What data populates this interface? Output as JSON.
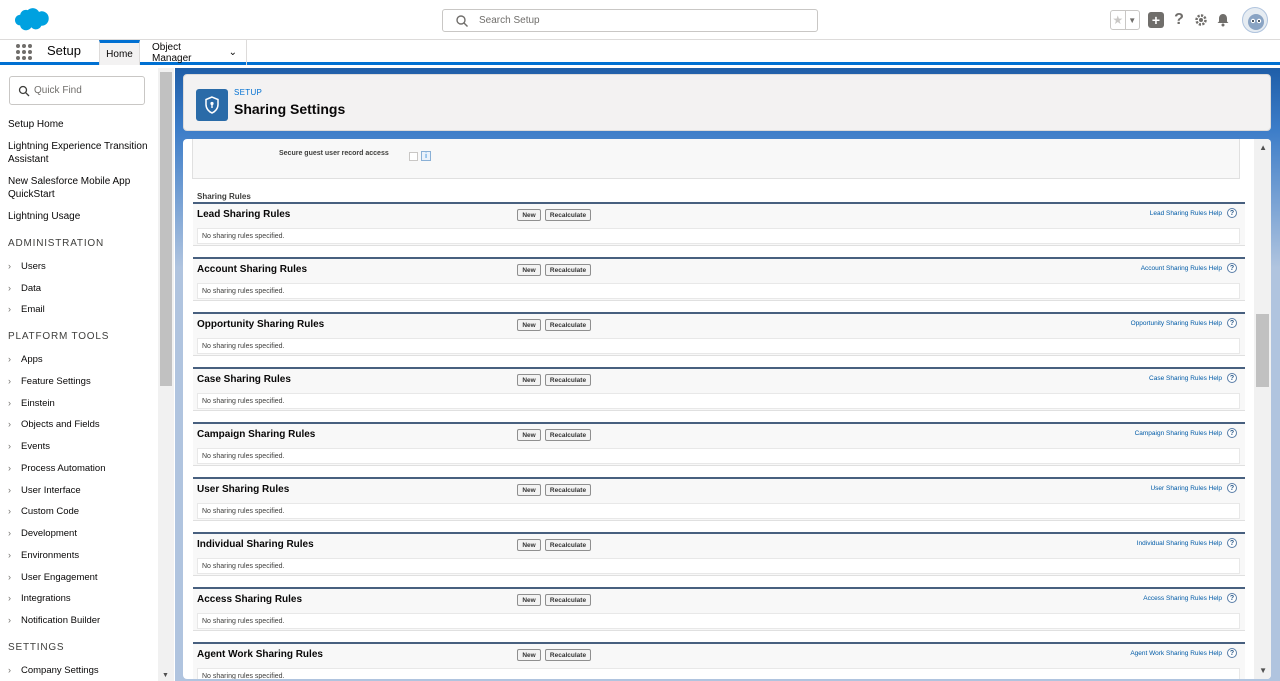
{
  "header": {
    "search_placeholder": "Search Setup",
    "icons": [
      "salesforce-cloud-logo",
      "search-icon",
      "star-icon",
      "chevron-down-icon",
      "plus-icon",
      "help-icon",
      "gear-icon",
      "bell-icon",
      "avatar"
    ]
  },
  "nav": {
    "app_name": "Setup",
    "tabs": [
      {
        "label": "Home"
      },
      {
        "label": "Object Manager"
      }
    ]
  },
  "sidebar": {
    "quick_find_placeholder": "Quick Find",
    "top_items": [
      "Setup Home",
      "Lightning Experience Transition Assistant",
      "New Salesforce Mobile App QuickStart",
      "Lightning Usage"
    ],
    "sections": [
      {
        "title": "ADMINISTRATION",
        "items": [
          "Users",
          "Data",
          "Email"
        ]
      },
      {
        "title": "PLATFORM TOOLS",
        "items": [
          "Apps",
          "Feature Settings",
          "Einstein",
          "Objects and Fields",
          "Events",
          "Process Automation",
          "User Interface",
          "Custom Code",
          "Development",
          "Environments",
          "User Engagement",
          "Integrations",
          "Notification Builder"
        ]
      },
      {
        "title": "SETTINGS",
        "items": [
          "Company Settings"
        ]
      }
    ]
  },
  "page_header": {
    "kicker": "SETUP",
    "title": "Sharing Settings"
  },
  "content": {
    "guest_access_label": "Secure guest user record access",
    "guest_info_glyph": "i",
    "sharing_rules_title": "Sharing Rules",
    "new_label": "New",
    "recalculate_label": "Recalculate",
    "empty_text": "No sharing rules specified.",
    "help_glyph": "?",
    "rules": [
      {
        "name": "Lead Sharing Rules",
        "help": "Lead Sharing Rules Help"
      },
      {
        "name": "Account Sharing Rules",
        "help": "Account Sharing Rules Help"
      },
      {
        "name": "Opportunity Sharing Rules",
        "help": "Opportunity Sharing Rules Help"
      },
      {
        "name": "Case Sharing Rules",
        "help": "Case Sharing Rules Help"
      },
      {
        "name": "Campaign Sharing Rules",
        "help": "Campaign Sharing Rules Help"
      },
      {
        "name": "User Sharing Rules",
        "help": "User Sharing Rules Help"
      },
      {
        "name": "Individual Sharing Rules",
        "help": "Individual Sharing Rules Help"
      },
      {
        "name": "Access Sharing Rules",
        "help": "Access Sharing Rules Help"
      },
      {
        "name": "Agent Work Sharing Rules",
        "help": "Agent Work Sharing Rules Help"
      }
    ]
  },
  "colors": {
    "brand_blue": "#0070d2",
    "salesforce_cloud": "#00a1e0",
    "section_border": "#48607f"
  }
}
